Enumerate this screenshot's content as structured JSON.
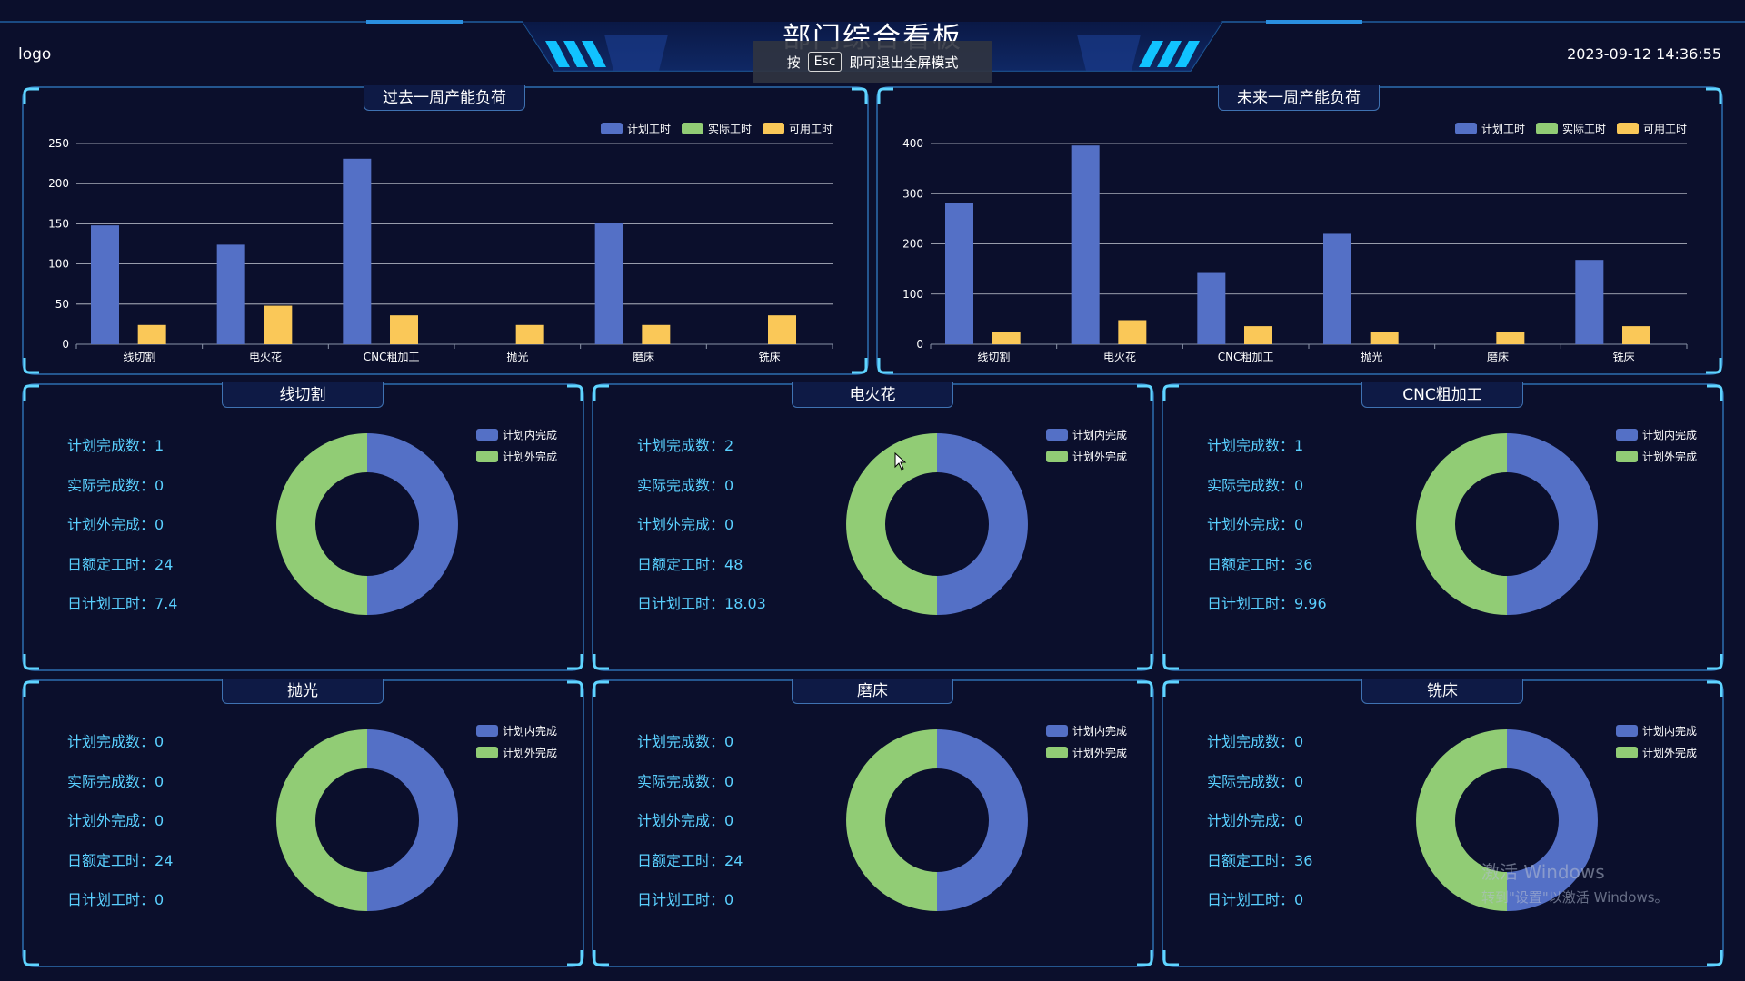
{
  "header": {
    "logo": "logo",
    "title": "部门综合看板",
    "datetime": "2023-09-12 14:36:55",
    "fullscreen_toast": {
      "prefix": "按",
      "key": "Esc",
      "suffix": "即可退出全屏模式"
    }
  },
  "colors": {
    "planned": "#5470c6",
    "actual": "#91cc75",
    "available": "#fac858",
    "accent": "#5ad0ff",
    "background": "#0b0f2c"
  },
  "legend_labels": {
    "planned": "计划工时",
    "actual": "实际工时",
    "available": "可用工时",
    "in_plan": "计划内完成",
    "out_plan": "计划外完成"
  },
  "chart_data": [
    {
      "type": "bar",
      "title": "过去一周产能负荷",
      "categories": [
        "线切割",
        "电火花",
        "CNC粗加工",
        "抛光",
        "磨床",
        "铣床"
      ],
      "series": [
        {
          "name": "计划工时",
          "values": [
            148,
            124,
            231,
            0,
            151,
            0
          ]
        },
        {
          "name": "实际工时",
          "values": [
            0,
            0,
            0,
            0,
            0,
            0
          ]
        },
        {
          "name": "可用工时",
          "values": [
            24,
            48,
            36,
            24,
            24,
            36
          ]
        }
      ],
      "ylim": [
        0,
        250
      ],
      "yticks": [
        0,
        50,
        100,
        150,
        200,
        250
      ],
      "grid": true,
      "legend": "top-right"
    },
    {
      "type": "bar",
      "title": "未来一周产能负荷",
      "categories": [
        "线切割",
        "电火花",
        "CNC粗加工",
        "抛光",
        "磨床",
        "铣床"
      ],
      "series": [
        {
          "name": "计划工时",
          "values": [
            282,
            396,
            142,
            220,
            0,
            168
          ]
        },
        {
          "name": "实际工时",
          "values": [
            0,
            0,
            0,
            0,
            0,
            0
          ]
        },
        {
          "name": "可用工时",
          "values": [
            24,
            48,
            36,
            24,
            24,
            36
          ]
        }
      ],
      "ylim": [
        0,
        400
      ],
      "yticks": [
        0,
        100,
        200,
        300,
        400
      ],
      "grid": true,
      "legend": "top-right"
    }
  ],
  "stat_labels": [
    "计划完成数：",
    "实际完成数：",
    "计划外完成：",
    "日额定工时：",
    "日计划工时："
  ],
  "departments": [
    {
      "name": "线切割",
      "stats": [
        "1",
        "0",
        "0",
        "24",
        "7.4"
      ],
      "donut": {
        "type": "pie",
        "series": [
          {
            "name": "计划内完成",
            "value": 50
          },
          {
            "name": "计划外完成",
            "value": 50
          }
        ]
      }
    },
    {
      "name": "电火花",
      "stats": [
        "2",
        "0",
        "0",
        "48",
        "18.03"
      ],
      "donut": {
        "type": "pie",
        "series": [
          {
            "name": "计划内完成",
            "value": 50
          },
          {
            "name": "计划外完成",
            "value": 50
          }
        ]
      }
    },
    {
      "name": "CNC粗加工",
      "stats": [
        "1",
        "0",
        "0",
        "36",
        "9.96"
      ],
      "donut": {
        "type": "pie",
        "series": [
          {
            "name": "计划内完成",
            "value": 50
          },
          {
            "name": "计划外完成",
            "value": 50
          }
        ]
      }
    },
    {
      "name": "抛光",
      "stats": [
        "0",
        "0",
        "0",
        "24",
        "0"
      ],
      "donut": {
        "type": "pie",
        "series": [
          {
            "name": "计划内完成",
            "value": 50
          },
          {
            "name": "计划外完成",
            "value": 50
          }
        ]
      }
    },
    {
      "name": "磨床",
      "stats": [
        "0",
        "0",
        "0",
        "24",
        "0"
      ],
      "donut": {
        "type": "pie",
        "series": [
          {
            "name": "计划内完成",
            "value": 50
          },
          {
            "name": "计划外完成",
            "value": 50
          }
        ]
      }
    },
    {
      "name": "铣床",
      "stats": [
        "0",
        "0",
        "0",
        "36",
        "0"
      ],
      "donut": {
        "type": "pie",
        "series": [
          {
            "name": "计划内完成",
            "value": 50
          },
          {
            "name": "计划外完成",
            "value": 50
          }
        ]
      }
    }
  ],
  "watermark": {
    "line1": "激活 Windows",
    "line2": "转到\"设置\"以激活 Windows。"
  }
}
